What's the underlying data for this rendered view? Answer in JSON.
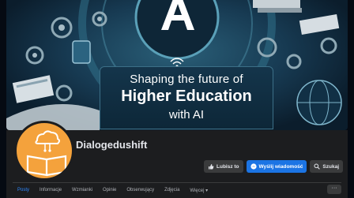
{
  "cover": {
    "line1": "Shaping the future of",
    "line2": "Higher Education",
    "line3": "with AI"
  },
  "page": {
    "name": "Dialogedushift"
  },
  "actions": {
    "like": "Lubisz to",
    "message": "Wyślij wiadomość",
    "search": "Szukaj"
  },
  "tabs": [
    "Posty",
    "Informacje",
    "Wzmianki",
    "Opinie",
    "Obserwujący",
    "Zdjęcia",
    "Więcej ▾"
  ],
  "more": "···",
  "colors": {
    "accent": "#1b74e4",
    "avatar": "#f4a23c",
    "header_bg": "#1c1d1f"
  }
}
